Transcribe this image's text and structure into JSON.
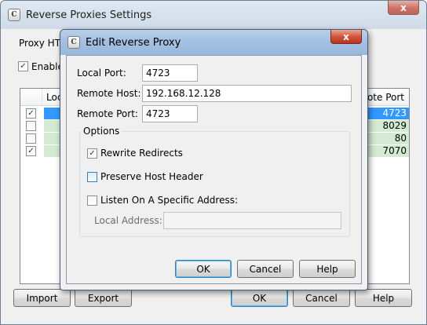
{
  "parent": {
    "title": "Reverse Proxies Settings",
    "proxy_label_partial": "Proxy HT",
    "enable_label_partial": "Enable",
    "table": {
      "header_local_partial": "Loc",
      "header_remote_partial": "ote Port",
      "rows": [
        {
          "checked": true,
          "remote_port": "4723",
          "selected": true
        },
        {
          "checked": false,
          "remote_port": "8029",
          "selected": false
        },
        {
          "checked": false,
          "remote_port": "80",
          "selected": false
        },
        {
          "checked": true,
          "remote_port": "7070",
          "selected": false
        }
      ]
    },
    "buttons": {
      "import": "Import",
      "export": "Export",
      "ok": "OK",
      "cancel": "Cancel",
      "help": "Help"
    },
    "close_glyph": "x"
  },
  "dialog": {
    "title": "Edit Reverse Proxy",
    "close_glyph": "x",
    "local_port_label": "Local Port:",
    "local_port_value": "4723",
    "remote_host_label": "Remote Host:",
    "remote_host_value": "192.168.12.128",
    "remote_port_label": "Remote Port:",
    "remote_port_value": "4723",
    "options_title": "Options",
    "options": {
      "rewrite_redirects": {
        "label": "Rewrite Redirects",
        "checked": true
      },
      "preserve_host_header": {
        "label": "Preserve Host Header",
        "checked": false
      },
      "listen_specific": {
        "label": "Listen On A Specific Address:",
        "checked": false
      }
    },
    "local_address_label": "Local Address:",
    "local_address_value": "",
    "buttons": {
      "ok": "OK",
      "cancel": "Cancel",
      "help": "Help"
    }
  },
  "colors": {
    "selected_row": "#3399ff",
    "green_row": "#cfe8cf",
    "close_red": "#c74b3b"
  }
}
